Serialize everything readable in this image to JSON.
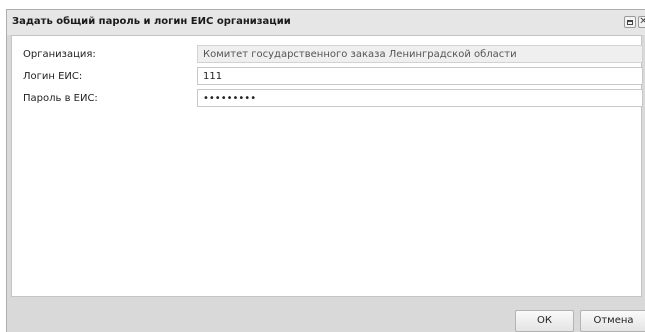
{
  "dialog": {
    "title": "Задать общий пароль и логин ЕИС организации",
    "fields": [
      {
        "label": "Организация:",
        "value": "Комитет государственного заказа Ленинградской области"
      },
      {
        "label": "Логин ЕИС:",
        "value": "111"
      },
      {
        "label": "Пароль в ЕИС:",
        "value": "•••••••••"
      }
    ],
    "buttons": {
      "ok": "ОК",
      "cancel": "Отмена"
    },
    "close_glyph": "✕"
  }
}
